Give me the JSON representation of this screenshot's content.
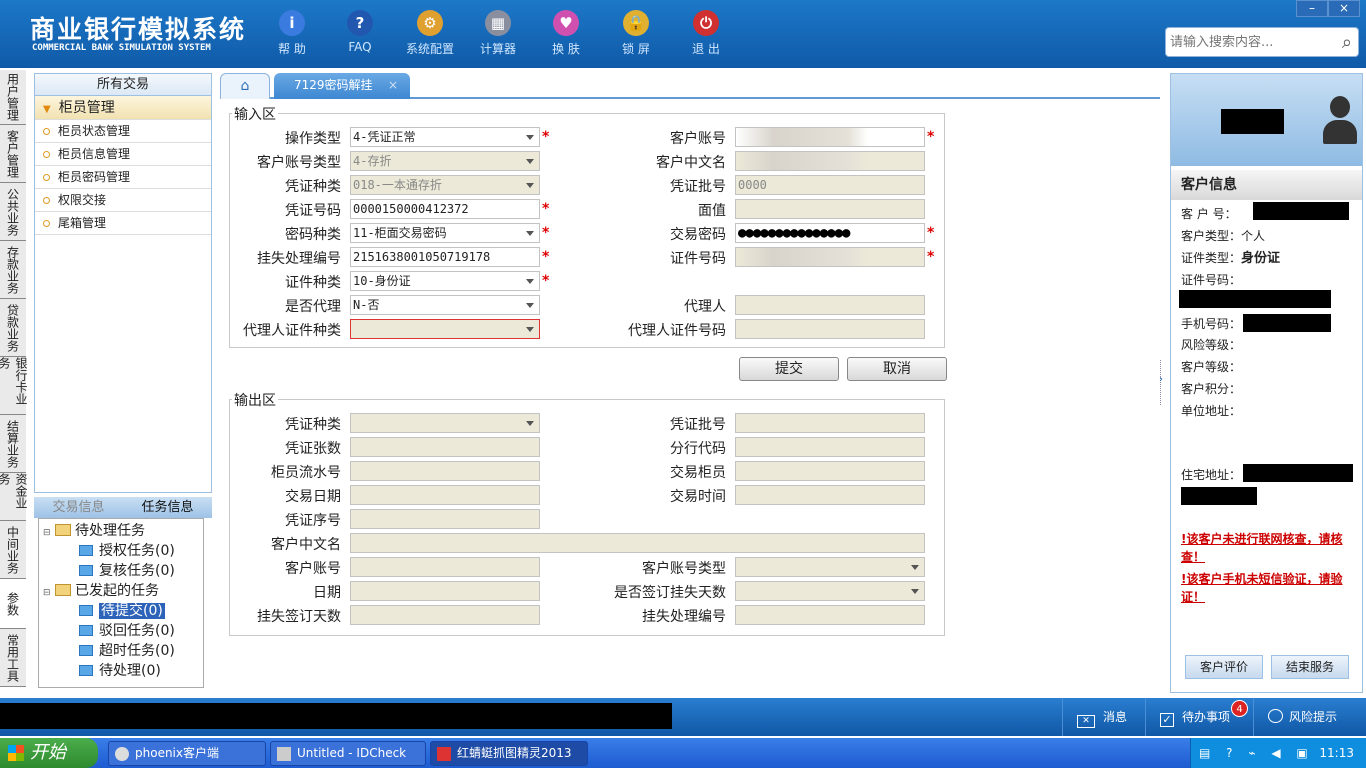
{
  "app": {
    "title": "商业银行模拟系统",
    "subtitle": "COMMERCIAL BANK SIMULATION SYSTEM"
  },
  "toolbar": [
    {
      "label": "帮 助",
      "icon": "help-icon",
      "color": "#3a7be0",
      "glyph": "i"
    },
    {
      "label": "FAQ",
      "icon": "faq-icon",
      "color": "#2257b0",
      "glyph": "?"
    },
    {
      "label": "系统配置",
      "icon": "config-toolbox-icon",
      "color": "#e0a030",
      "glyph": "⚙"
    },
    {
      "label": "计算器",
      "icon": "calculator-icon",
      "color": "#8a8fa0",
      "glyph": "▦"
    },
    {
      "label": "换 肤",
      "icon": "skin-shirt-icon",
      "color": "#d050b0",
      "glyph": "♥"
    },
    {
      "label": "锁 屏",
      "icon": "lock-icon",
      "color": "#e0b030",
      "glyph": "🔒"
    },
    {
      "label": "退 出",
      "icon": "power-icon",
      "color": "#d03030",
      "glyph": "⏻"
    }
  ],
  "window_controls": {
    "minimize": "–",
    "close": "×"
  },
  "search": {
    "placeholder": "请输入搜索内容..."
  },
  "vtabs": [
    "用户管理",
    "客户管理",
    "公共业务",
    "存款业务",
    "贷款业务",
    "银行卡业务",
    "结算业务",
    "资金业务",
    "中间业务",
    "参数",
    "常用工具"
  ],
  "left_panel": {
    "header": "所有交易",
    "group": "柜员管理",
    "items": [
      "柜员状态管理",
      "柜员信息管理",
      "柜员密码管理",
      "权限交接",
      "尾箱管理"
    ]
  },
  "task_tabs": {
    "trade": "交易信息",
    "task": "任务信息"
  },
  "task_tree": {
    "pending": "待处理任务",
    "auth": "授权任务(0)",
    "review": "复核任务(0)",
    "initiated": "已发起的任务",
    "to_submit": "待提交(0)",
    "rejected": "驳回任务(0)",
    "timeout": "超时任务(0)",
    "to_process": "待处理(0)"
  },
  "tabs": {
    "current": "7129密码解挂",
    "close": "×"
  },
  "input": {
    "legend": "输入区",
    "left": [
      {
        "label": "操作类型",
        "value": "4-凭证正常",
        "ro": false,
        "dd": true,
        "req": true
      },
      {
        "label": "客户账号类型",
        "value": "4-存折",
        "ro": true,
        "dd": true,
        "req": false
      },
      {
        "label": "凭证种类",
        "value": "018-一本通存折",
        "ro": true,
        "dd": true,
        "req": false
      },
      {
        "label": "凭证号码",
        "value": "0000150000412372",
        "ro": false,
        "dd": false,
        "req": true
      },
      {
        "label": "密码种类",
        "value": "11-柜面交易密码",
        "ro": false,
        "dd": true,
        "req": true
      },
      {
        "label": "挂失处理编号",
        "value": "2151638001050719178",
        "ro": false,
        "dd": false,
        "req": true
      },
      {
        "label": "证件种类",
        "value": "10-身份证",
        "ro": false,
        "dd": true,
        "req": true
      },
      {
        "label": "是否代理",
        "value": "N-否",
        "ro": false,
        "dd": true,
        "req": false
      },
      {
        "label": "代理人证件种类",
        "value": "",
        "ro": true,
        "dd": true,
        "req": false,
        "red": true
      }
    ],
    "right": [
      {
        "label": "客户账号",
        "value": "",
        "ro": false,
        "blur": true,
        "req": true
      },
      {
        "label": "客户中文名",
        "value": "",
        "ro": true,
        "blur": true,
        "req": false
      },
      {
        "label": "凭证批号",
        "value": "0000",
        "ro": true,
        "req": false
      },
      {
        "label": "面值",
        "value": "",
        "ro": true,
        "req": false
      },
      {
        "label": "交易密码",
        "value": "●●●●●●●●●●●●●●●",
        "ro": false,
        "req": true
      },
      {
        "label": "证件号码",
        "value": "",
        "ro": true,
        "blur": true,
        "req": true
      },
      {
        "label": "代理人",
        "value": "",
        "ro": true,
        "req": false
      },
      {
        "label": "代理人证件号码",
        "value": "",
        "ro": true,
        "req": false
      }
    ],
    "submit": "提交",
    "cancel": "取消"
  },
  "output": {
    "legend": "输出区",
    "left": [
      "凭证种类",
      "凭证张数",
      "柜员流水号",
      "交易日期",
      "凭证序号"
    ],
    "right": [
      "凭证批号",
      "分行代码",
      "交易柜员",
      "交易时间"
    ],
    "full": "客户中文名",
    "bottom": [
      [
        "客户账号",
        "客户账号类型"
      ],
      [
        "日期",
        "是否签订挂失天数"
      ],
      [
        "挂失签订天数",
        "挂失处理编号"
      ]
    ]
  },
  "customer": {
    "title": "客户信息",
    "labels": {
      "no": "客 户 号：",
      "type": "客户类型：",
      "type_val": "个人",
      "idtype": "证件类型：",
      "idtype_val": "身份证",
      "idno": "证件号码：",
      "phone": "手机号码：",
      "risk": "风险等级：",
      "level": "客户等级：",
      "points": "客户积分：",
      "company": "单位地址：",
      "home": "住宅地址："
    },
    "warn1": "!该客户未进行联网核查，请核查！",
    "warn2": "!该客户手机未短信验证，请验证！",
    "btn_eval": "客户评价",
    "btn_end": "结束服务"
  },
  "statusbar": {
    "msg": "消息",
    "todo": "待办事项",
    "todo_count": "4",
    "risk": "风险提示"
  },
  "taskbar": {
    "start": "开始",
    "items": [
      "phoenix客户端",
      "Untitled - IDCheck",
      "红蜻蜓抓图精灵2013"
    ],
    "time": "11:13"
  }
}
